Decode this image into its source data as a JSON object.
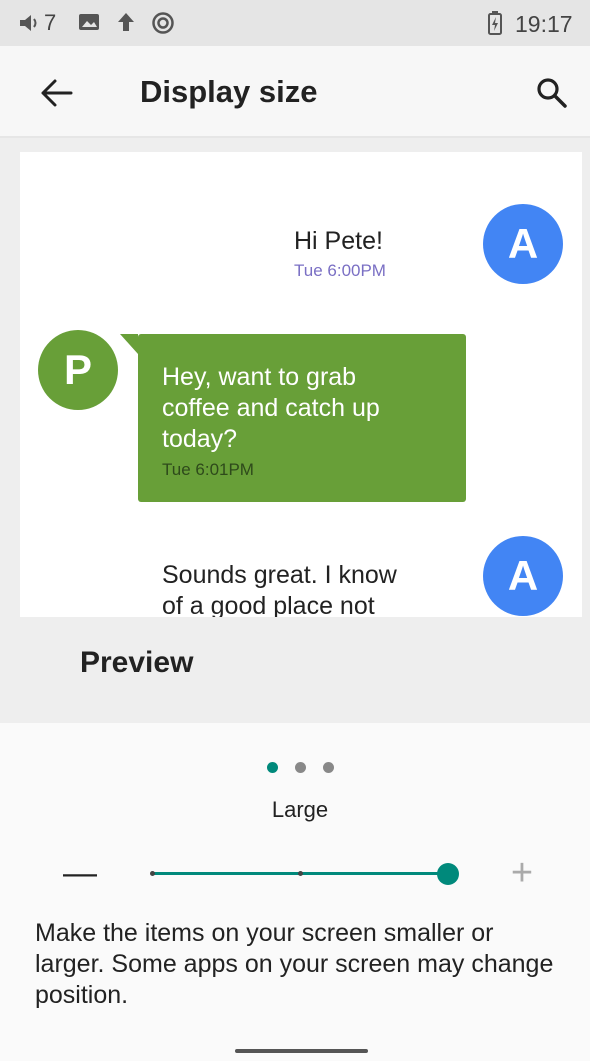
{
  "status_bar": {
    "volume_level": "7",
    "time": "19:17",
    "icons": [
      "volume-icon",
      "image-icon",
      "upload-icon",
      "sync-icon",
      "battery-charging-icon"
    ]
  },
  "app_bar": {
    "title": "Display size",
    "back_icon": "arrow-left-icon",
    "search_icon": "search-icon"
  },
  "preview": {
    "label": "Preview",
    "messages": [
      {
        "sender_initial": "A",
        "text_lines": [
          "Hi Pete!"
        ],
        "time": "Tue 6:00PM"
      },
      {
        "sender_initial": "P",
        "text_lines": [
          "Hey, want to grab",
          "coffee and catch up",
          "today?"
        ],
        "time": "Tue 6:01PM"
      },
      {
        "sender_initial": "A",
        "text_lines": [
          "Sounds great. I know",
          "of a good place not"
        ],
        "time": ""
      }
    ]
  },
  "size_control": {
    "current_label": "Large",
    "page_indicator": {
      "count": 3,
      "active_index": 0
    },
    "slider": {
      "steps": 3,
      "selected_step": 3
    },
    "minus_label": "—",
    "plus_label": "+"
  },
  "description": "Make the items on your screen smaller or larger. Some apps on your screen may change position.",
  "colors": {
    "accent": "#00897b",
    "avatar_a": "#4285f4",
    "avatar_p": "#689f38",
    "bubble": "#689f38",
    "timestamp": "#7a6fc4"
  }
}
